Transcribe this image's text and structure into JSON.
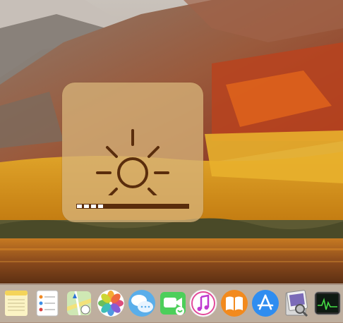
{
  "hud": {
    "icon": "brightness-sun-icon",
    "brightness_level": 0.25,
    "segments_total": 16,
    "segments_on": 4,
    "colors": {
      "glyph": "#5a2d0c",
      "fill": "#ffffff"
    }
  },
  "dock": {
    "items": [
      {
        "id": "notes",
        "icon": "notes-icon"
      },
      {
        "id": "reminders",
        "icon": "reminders-icon"
      },
      {
        "id": "maps",
        "icon": "maps-icon"
      },
      {
        "id": "photos",
        "icon": "photos-icon"
      },
      {
        "id": "messages",
        "icon": "messages-icon"
      },
      {
        "id": "facetime",
        "icon": "facetime-icon"
      },
      {
        "id": "itunes",
        "icon": "itunes-icon"
      },
      {
        "id": "ibooks",
        "icon": "ibooks-icon"
      },
      {
        "id": "app-store",
        "icon": "app-store-icon"
      },
      {
        "id": "preview",
        "icon": "preview-icon"
      },
      {
        "id": "activity-monitor",
        "icon": "activity-monitor-icon"
      }
    ]
  }
}
